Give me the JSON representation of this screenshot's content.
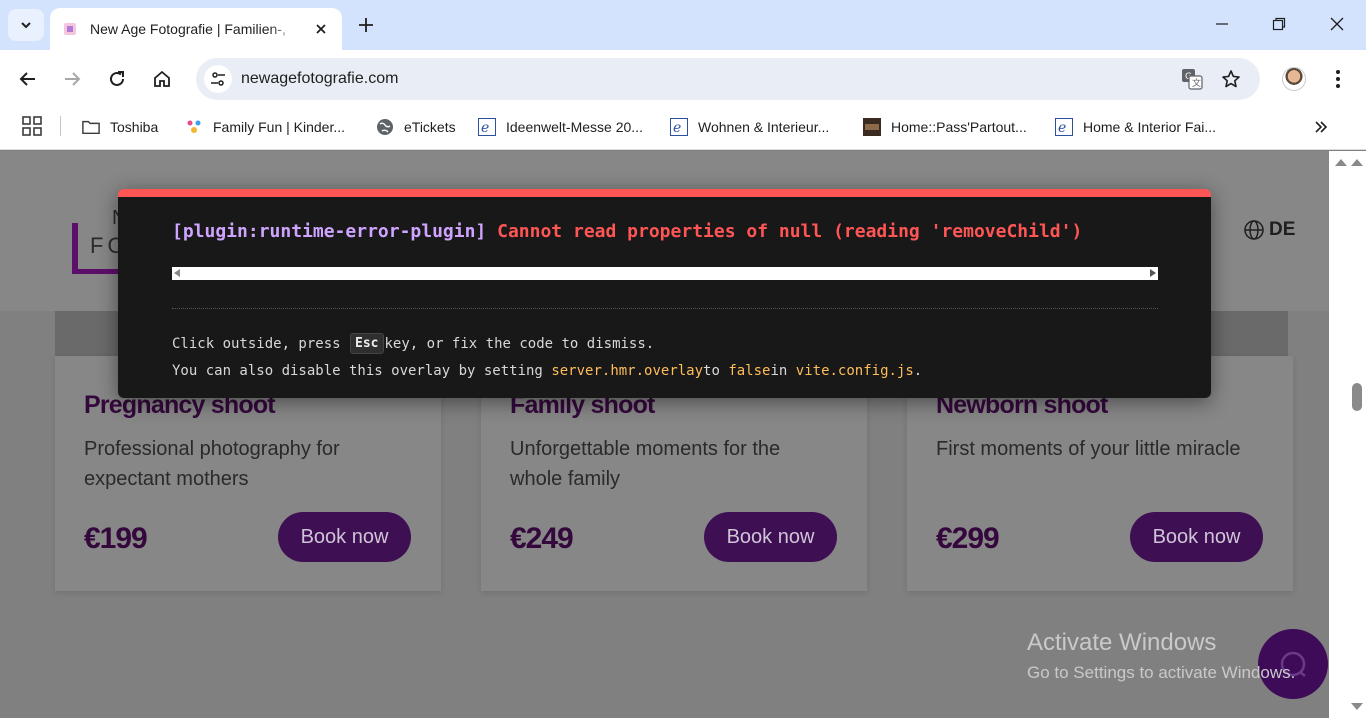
{
  "browser": {
    "tab_title": "New Age Fotografie | Familien-,",
    "url": "newagefotografie.com"
  },
  "bookmarks": [
    {
      "label": "Toshiba",
      "icon": "folder-icon"
    },
    {
      "label": "Family Fun | Kinder...",
      "icon": "family-fun-favicon"
    },
    {
      "label": "eTickets",
      "icon": "globe-icon"
    },
    {
      "label": "Ideenwelt-Messe 20...",
      "icon": "e-favicon"
    },
    {
      "label": "Wohnen & Interieur...",
      "icon": "e-favicon"
    },
    {
      "label": "Home::Pass'Partout...",
      "icon": "passpartout-favicon"
    },
    {
      "label": "Home & Interior Fai...",
      "icon": "e-favicon"
    }
  ],
  "site": {
    "logo_line1": "N",
    "logo_line2": "FO",
    "language": "DE"
  },
  "cards": [
    {
      "title": "Pregnancy shoot",
      "description": "Professional photography for expectant mothers",
      "price": "€199",
      "button": "Book now"
    },
    {
      "title": "Family shoot",
      "description": "Unforgettable moments for the whole family",
      "price": "€249",
      "button": "Book now"
    },
    {
      "title": "Newborn shoot",
      "description": "First moments of your little miracle",
      "price": "€299",
      "button": "Book now"
    }
  ],
  "error_overlay": {
    "plugin": "[plugin:runtime-error-plugin]",
    "message": "Cannot read properties of null (reading 'removeChild')",
    "tip1_before": "Click outside, press",
    "tip1_key": "Esc",
    "tip1_after": "key, or fix the code to dismiss.",
    "tip2_before": "You can also disable this overlay by setting",
    "tip2_code1": "server.hmr.overlay",
    "tip2_mid1": "to",
    "tip2_code2": "false",
    "tip2_mid2": "in",
    "tip2_code3": "vite.config.js",
    "tip2_end": "."
  },
  "watermark": {
    "title": "Activate Windows",
    "subtitle": "Go to Settings to activate Windows."
  },
  "colors": {
    "brand_purple": "#3f0f54",
    "error_red": "#ff5555",
    "plugin_violet": "#cfa4ff",
    "code_yellow": "#ffbd59"
  }
}
